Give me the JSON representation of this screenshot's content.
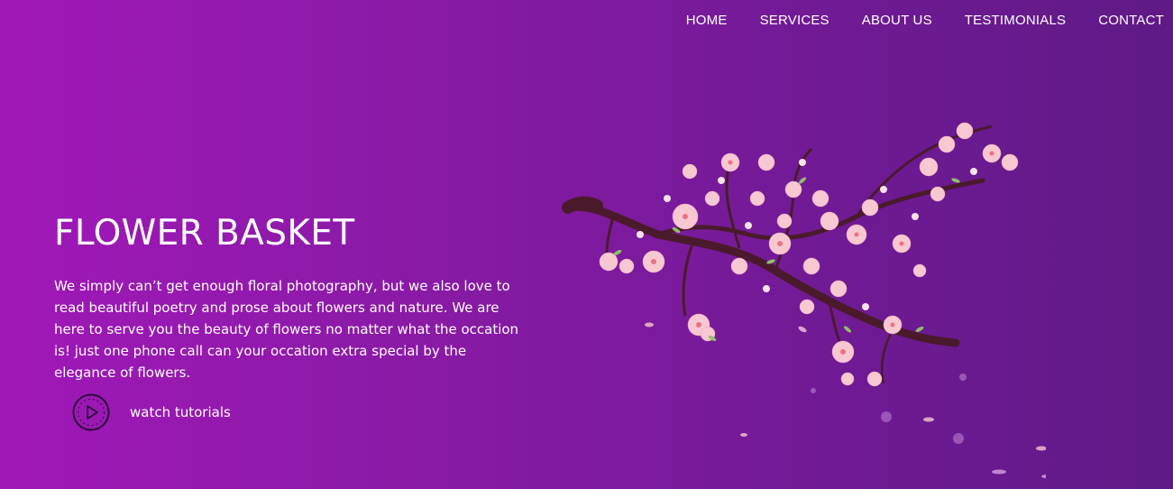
{
  "nav": {
    "items": [
      {
        "label": "HOME"
      },
      {
        "label": "SERVICES"
      },
      {
        "label": "ABOUT US"
      },
      {
        "label": "TESTIMONIALS"
      },
      {
        "label": "CONTACT"
      }
    ]
  },
  "hero": {
    "title": "FLOWER BASKET",
    "description": "We simply can’t get enough floral photography, but we also love to read beautiful poetry and prose about flowers and nature. We are here to serve you the beauty of flowers no matter what the occation is! just one phone call can your occation extra special by the elegance of flowers.",
    "watch_label": "watch tutorials",
    "watch_icon": "play-circle-icon"
  },
  "illustration": {
    "name": "cherry-blossom-branch"
  },
  "colors": {
    "gradient_start": "#a018b8",
    "gradient_end": "#5f1a86",
    "blossom": "#f7c7d2",
    "blossom_center": "#e9737e",
    "branch": "#4a1a2c",
    "leaf": "#8fbf6a"
  }
}
